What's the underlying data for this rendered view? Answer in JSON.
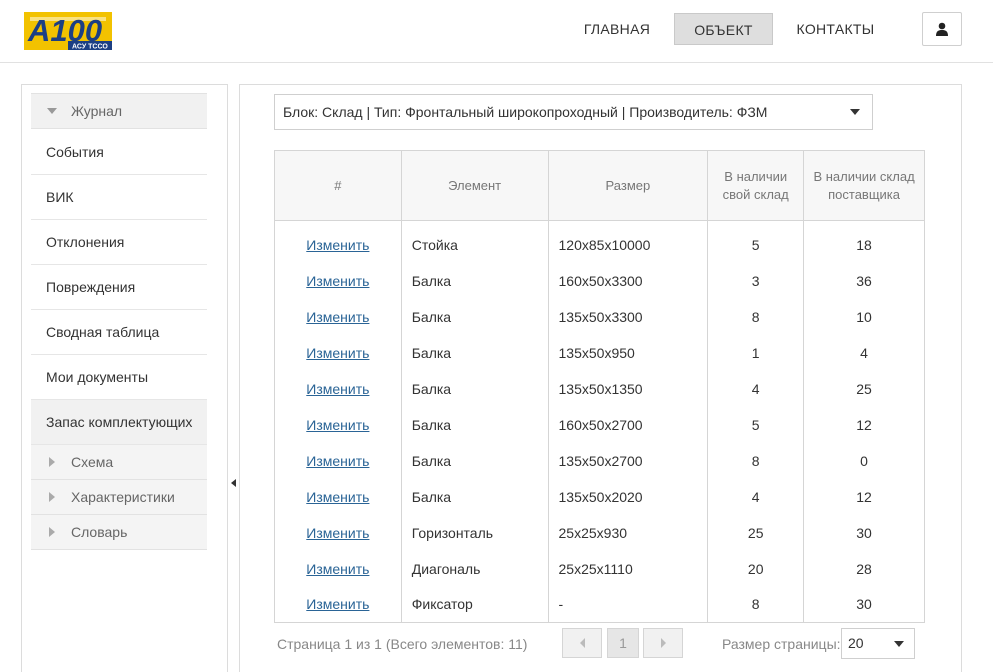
{
  "header": {
    "logo": {
      "main": "A100",
      "sub": "АСУ ТССО"
    },
    "nav": [
      {
        "label": "ГЛАВНАЯ",
        "active": false
      },
      {
        "label": "ОБЪЕКТ",
        "active": true
      },
      {
        "label": "КОНТАКТЫ",
        "active": false
      }
    ],
    "user_icon": "user-icon"
  },
  "sidebar": {
    "section_label": "Журнал",
    "items": [
      {
        "label": "События"
      },
      {
        "label": "ВИК"
      },
      {
        "label": "Отклонения"
      },
      {
        "label": "Повреждения"
      },
      {
        "label": "Сводная таблица"
      },
      {
        "label": "Мои документы"
      },
      {
        "label": "Запас комплектующих",
        "active": true
      }
    ],
    "sub_items": [
      {
        "label": "Схема"
      },
      {
        "label": "Характеристики"
      },
      {
        "label": "Словарь"
      }
    ]
  },
  "filter": {
    "value": "Блок: Склад | Тип: Фронтальный широкопроходный | Производитель: ФЗМ"
  },
  "table": {
    "columns": [
      "#",
      "Элемент",
      "Размер",
      "В наличии свой склад",
      "В наличии склад поставщика"
    ],
    "rows": [
      {
        "action": "Изменить",
        "element": "Стойка",
        "size": "120x85x10000",
        "own": "5",
        "supplier": "18"
      },
      {
        "action": "Изменить",
        "element": "Балка",
        "size": "160x50x3300",
        "own": "3",
        "supplier": "36"
      },
      {
        "action": "Изменить",
        "element": "Балка",
        "size": "135x50x3300",
        "own": "8",
        "supplier": "10"
      },
      {
        "action": "Изменить",
        "element": "Балка",
        "size": "135x50x950",
        "own": "1",
        "supplier": "4"
      },
      {
        "action": "Изменить",
        "element": "Балка",
        "size": "135x50x1350",
        "own": "4",
        "supplier": "25"
      },
      {
        "action": "Изменить",
        "element": "Балка",
        "size": "160x50x2700",
        "own": "5",
        "supplier": "12"
      },
      {
        "action": "Изменить",
        "element": "Балка",
        "size": "135x50x2700",
        "own": "8",
        "supplier": "0"
      },
      {
        "action": "Изменить",
        "element": "Балка",
        "size": "135x50x2020",
        "own": "4",
        "supplier": "12"
      },
      {
        "action": "Изменить",
        "element": "Горизонталь",
        "size": "25x25x930",
        "own": "25",
        "supplier": "30"
      },
      {
        "action": "Изменить",
        "element": "Диагональ",
        "size": "25x25x1110",
        "own": "20",
        "supplier": "28"
      },
      {
        "action": "Изменить",
        "element": "Фиксатор",
        "size": "-",
        "own": "8",
        "supplier": "30"
      }
    ]
  },
  "pager": {
    "info": "Страница 1 из 1 (Всего элементов: 11)",
    "current_page": "1",
    "size_label": "Размер страницы:",
    "page_size": "20"
  },
  "colors": {
    "link": "#2a6496",
    "logo_yellow": "#f2c200",
    "logo_blue": "#1c3f84"
  }
}
